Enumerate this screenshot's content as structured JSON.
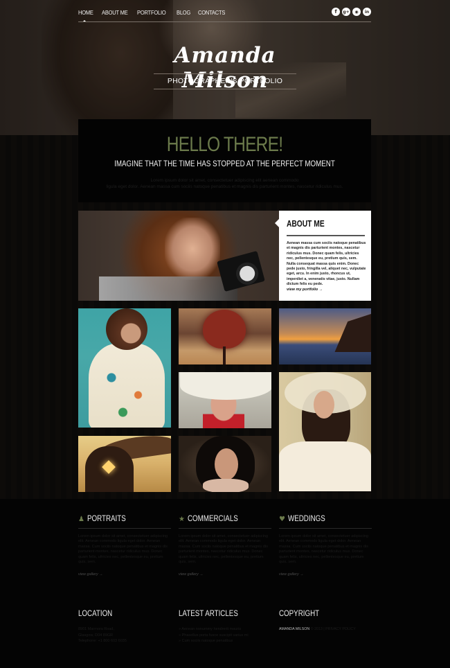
{
  "nav": {
    "items": [
      {
        "label": "HOME",
        "active": true
      },
      {
        "label": "ABOUT ME"
      },
      {
        "label": "PORTFOLIO"
      },
      {
        "label": "BLOG"
      },
      {
        "label": "CONTACTS"
      }
    ]
  },
  "social": [
    {
      "icon": "facebook-icon",
      "glyph": "f"
    },
    {
      "icon": "google-plus-icon",
      "glyph": "g+"
    },
    {
      "icon": "rss-icon",
      "glyph": "◉"
    },
    {
      "icon": "linkedin-icon",
      "glyph": "in"
    }
  ],
  "header": {
    "logo": "Amanda Milson",
    "tagline": "PHOTOGRAPHER'S PORTFOLIO"
  },
  "intro": {
    "title": "HELLO THERE!",
    "subtitle": "IMAGINE THAT THE TIME HAS STOPPED AT THE PERFECT MOMENT",
    "text_line1": "Lorem ipsum dolor sit amet, consectetuer adipiscing elit aenean commodo",
    "text_line2": "ligula eget dolor. Aenean massa cum sociis natoque penatibus et magnis dis parturient montes, nascetur ridiculus mus."
  },
  "about": {
    "title": "ABOUT ME",
    "text": "Aenean massa cum sociis natoque penatibus et magnis dis parturient montes, nascetur ridiculus mus. Donec quam felis, ultricies nec, pellentesque eu, pretium quis, sem. Nulla consequat massa quis enim. Donec pede justo, fringilla vel, aliquet nec, vulputate eget, arcu. In enim justo, rhoncus ut, imperdiet a, venenatis vitae, justo. Nullam dictum felis eu pede.",
    "link": "view my portfolio →"
  },
  "gallery": [
    {
      "subject": "woman in floral dress"
    },
    {
      "subject": "heart-shaped tree"
    },
    {
      "subject": "sunset over sea cliff"
    },
    {
      "subject": "child under umbrella"
    },
    {
      "subject": "woman in sun hat"
    },
    {
      "subject": "couple silhouette with heart"
    },
    {
      "subject": "woman with dark curly hair"
    }
  ],
  "services": [
    {
      "icon": "person-icon",
      "glyph": "👤",
      "title": "PORTRAITS",
      "text": "Lorem ipsum dolor sit amet, consectetuer adipiscing elit. Aenean commodo ligula eget dolor. Aenean massa. Cum sociis natoque penatibus et magnis dis parturient montes, nascetur ridiculus mus. Donec quam felis, ultricies nec, pellentesque eu, pretium quis, sem.",
      "link": "view gallery →"
    },
    {
      "icon": "star-icon",
      "glyph": "★",
      "title": "COMMERCIALS",
      "text": "Lorem ipsum dolor sit amet, consectetuer adipiscing elit. Aenean commodo ligula eget dolor. Aenean massa. Cum sociis natoque penatibus et magnis dis parturient montes, nascetur ridiculus mus. Donec quam felis, ultricies nec, pellentesque eu, pretium quis, sem.",
      "link": "view gallery →"
    },
    {
      "icon": "heart-icon",
      "glyph": "♥",
      "title": "WEDDINGS",
      "text": "Lorem ipsum dolor sit amet, consectetuer adipiscing elit. Aenean commodo ligula eget dolor. Aenean massa. Cum sociis natoque penatibus et magnis dis parturient montes, nascetur ridiculus mus. Donec quam felis, ultricies nec, pellentesque eu, pretium quis, sem.",
      "link": "view gallery →"
    }
  ],
  "footer": {
    "location": {
      "title": "LOCATION",
      "lines": [
        "8901 Marmora Road,",
        "Glasgow, D04 89GR",
        "Telephone: +1 800 603 6035"
      ]
    },
    "articles": {
      "title": "LATEST ARTICLES",
      "items": [
        "Aenean nonummy hendrerit mauris",
        "Phasellus porta fusce suscipit varius mi",
        "Cum sociis natoque penatibus"
      ]
    },
    "copyright": {
      "title": "COPYRIGHT",
      "owner": "AMANDA MILSON",
      "rest": " © 2013 | PRIVACY POLICY"
    }
  },
  "colors": {
    "accent": "#6b7a4b",
    "background": "#050505",
    "panel": "#ffffff"
  }
}
